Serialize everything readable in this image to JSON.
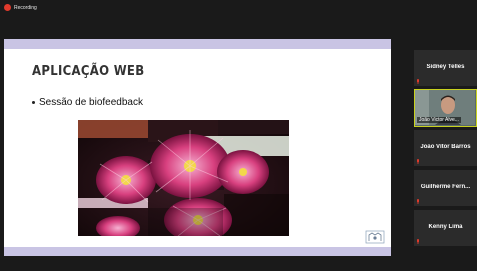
{
  "recording": {
    "label": "Recording"
  },
  "slide": {
    "title": "APLICAÇÃO WEB",
    "bullet": "Sessão de biofeedback",
    "image_name": "pink-flower-photo"
  },
  "participants": [
    {
      "name": "Sidney Telles"
    },
    {
      "name": "João Victor Alve...",
      "active": true
    },
    {
      "name": "João Vitor Barros"
    },
    {
      "name": "Guilherme  Fern..."
    },
    {
      "name": "Kenny Lima"
    }
  ],
  "colors": {
    "slide_band": "#c9c4e4",
    "recording_dot": "#e03a2c",
    "active_speaker_border": "#c8d11f",
    "mic_muted": "#e03a2c"
  }
}
